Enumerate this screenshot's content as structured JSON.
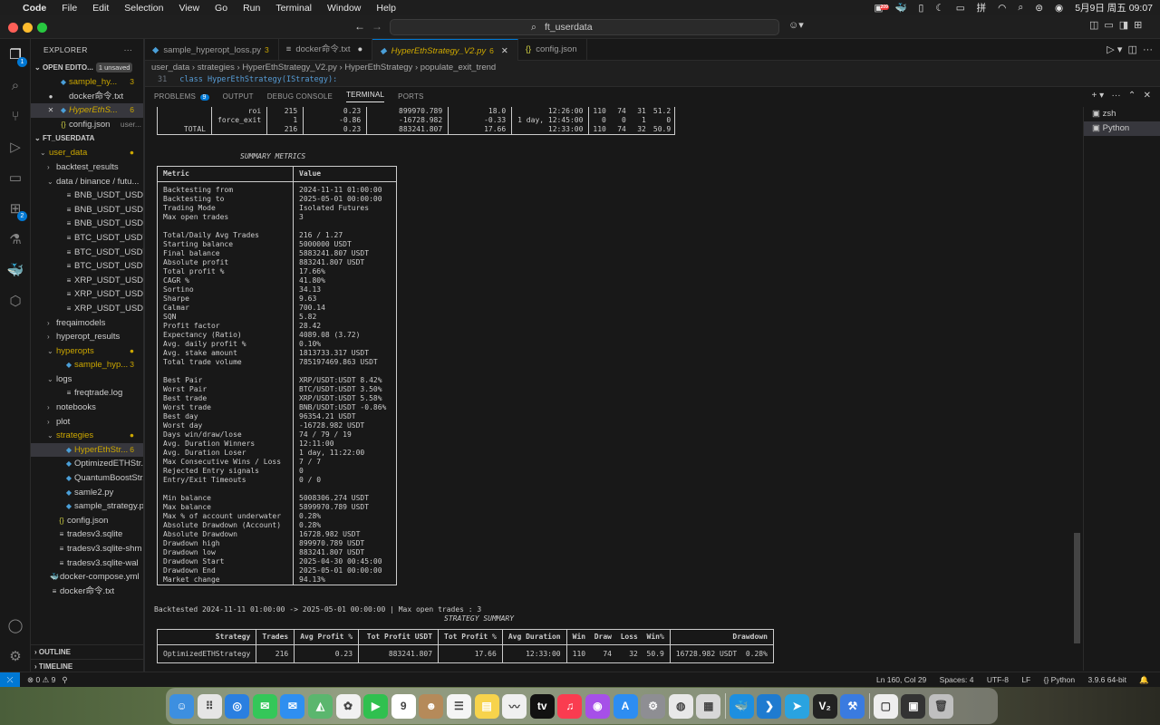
{
  "menubar": {
    "app": "Code",
    "items": [
      "File",
      "Edit",
      "Selection",
      "View",
      "Go",
      "Run",
      "Terminal",
      "Window",
      "Help"
    ],
    "ime": "拼",
    "datetime": "5月9日 周五  09:07",
    "notif_badge": "209"
  },
  "titlebar": {
    "search": "ft_userdata"
  },
  "activity": {
    "source_control_badge": "2",
    "extensions_badge": "2"
  },
  "sidebar": {
    "title": "EXPLORER",
    "open_editors_label": "OPEN EDITO...",
    "unsaved_label": "1 unsaved",
    "open_editors": [
      {
        "name": "sample_hy...",
        "badge": "3",
        "lead": "",
        "icon": "python-file-icon",
        "cls": "pyc",
        "glyph": "◆"
      },
      {
        "name": "docker命令.txt",
        "badge": "",
        "lead": "●",
        "icon": "text-file-icon",
        "cls": "",
        "glyph": ""
      },
      {
        "name": "HyperEthS...",
        "badge": "6",
        "lead": "✕",
        "icon": "python-file-icon",
        "cls": "pyc",
        "glyph": "◆"
      },
      {
        "name": "config.json",
        "badge": "user...",
        "lead": "",
        "icon": "json-file-icon",
        "cls": "jsc",
        "glyph": "{}"
      }
    ],
    "workspace_label": "FT_USERDATA",
    "tree": [
      {
        "indent": 0,
        "tw": "⌄",
        "name": "user_data",
        "badge": "●",
        "cls": "",
        "glyph": "",
        "color": "#cca700"
      },
      {
        "indent": 1,
        "tw": "›",
        "name": "backtest_results",
        "badge": "",
        "cls": "",
        "glyph": ""
      },
      {
        "indent": 1,
        "tw": "⌄",
        "name": "data / binance / futu...",
        "badge": "",
        "cls": "",
        "glyph": ""
      },
      {
        "indent": 2,
        "tw": "",
        "name": "BNB_USDT_USDT...",
        "badge": "",
        "cls": "",
        "glyph": "≡"
      },
      {
        "indent": 2,
        "tw": "",
        "name": "BNB_USDT_USDT...",
        "badge": "",
        "cls": "",
        "glyph": "≡"
      },
      {
        "indent": 2,
        "tw": "",
        "name": "BNB_USDT_USDT...",
        "badge": "",
        "cls": "",
        "glyph": "≡"
      },
      {
        "indent": 2,
        "tw": "",
        "name": "BTC_USDT_USDT...",
        "badge": "",
        "cls": "",
        "glyph": "≡"
      },
      {
        "indent": 2,
        "tw": "",
        "name": "BTC_USDT_USDT...",
        "badge": "",
        "cls": "",
        "glyph": "≡"
      },
      {
        "indent": 2,
        "tw": "",
        "name": "BTC_USDT_USDT...",
        "badge": "",
        "cls": "",
        "glyph": "≡"
      },
      {
        "indent": 2,
        "tw": "",
        "name": "XRP_USDT_USDT...",
        "badge": "",
        "cls": "",
        "glyph": "≡"
      },
      {
        "indent": 2,
        "tw": "",
        "name": "XRP_USDT_USDT...",
        "badge": "",
        "cls": "",
        "glyph": "≡"
      },
      {
        "indent": 2,
        "tw": "",
        "name": "XRP_USDT_USDT...",
        "badge": "",
        "cls": "",
        "glyph": "≡"
      },
      {
        "indent": 1,
        "tw": "›",
        "name": "freqaimodels",
        "badge": "",
        "cls": "",
        "glyph": ""
      },
      {
        "indent": 1,
        "tw": "›",
        "name": "hyperopt_results",
        "badge": "",
        "cls": "",
        "glyph": ""
      },
      {
        "indent": 1,
        "tw": "⌄",
        "name": "hyperopts",
        "badge": "●",
        "cls": "",
        "glyph": "",
        "color": "#cca700"
      },
      {
        "indent": 2,
        "tw": "",
        "name": "sample_hyp...",
        "badge": "3",
        "cls": "pyc",
        "glyph": "◆",
        "color": "#cca700"
      },
      {
        "indent": 1,
        "tw": "⌄",
        "name": "logs",
        "badge": "",
        "cls": "",
        "glyph": ""
      },
      {
        "indent": 2,
        "tw": "",
        "name": "freqtrade.log",
        "badge": "",
        "cls": "",
        "glyph": "≡"
      },
      {
        "indent": 1,
        "tw": "›",
        "name": "notebooks",
        "badge": "",
        "cls": "",
        "glyph": ""
      },
      {
        "indent": 1,
        "tw": "›",
        "name": "plot",
        "badge": "",
        "cls": "",
        "glyph": ""
      },
      {
        "indent": 1,
        "tw": "⌄",
        "name": "strategies",
        "badge": "●",
        "cls": "",
        "glyph": "",
        "color": "#cca700"
      },
      {
        "indent": 2,
        "tw": "",
        "name": "HyperEthStr...",
        "badge": "6",
        "cls": "pyc",
        "glyph": "◆",
        "color": "#cca700",
        "sel": true
      },
      {
        "indent": 2,
        "tw": "",
        "name": "OptimizedETHStr...",
        "badge": "",
        "cls": "pyc",
        "glyph": "◆"
      },
      {
        "indent": 2,
        "tw": "",
        "name": "QuantumBoostStr...",
        "badge": "",
        "cls": "pyc",
        "glyph": "◆"
      },
      {
        "indent": 2,
        "tw": "",
        "name": "samle2.py",
        "badge": "",
        "cls": "pyc",
        "glyph": "◆"
      },
      {
        "indent": 2,
        "tw": "",
        "name": "sample_strategy.py",
        "badge": "",
        "cls": "pyc",
        "glyph": "◆"
      },
      {
        "indent": 1,
        "tw": "",
        "name": "config.json",
        "badge": "",
        "cls": "jsc",
        "glyph": "{}"
      },
      {
        "indent": 1,
        "tw": "",
        "name": "tradesv3.sqlite",
        "badge": "",
        "cls": "",
        "glyph": "≡"
      },
      {
        "indent": 1,
        "tw": "",
        "name": "tradesv3.sqlite-shm",
        "badge": "",
        "cls": "",
        "glyph": "≡"
      },
      {
        "indent": 1,
        "tw": "",
        "name": "tradesv3.sqlite-wal",
        "badge": "",
        "cls": "",
        "glyph": "≡"
      },
      {
        "indent": 0,
        "tw": "",
        "name": "docker-compose.yml",
        "badge": "",
        "cls": "yc",
        "glyph": "🐳"
      },
      {
        "indent": 0,
        "tw": "",
        "name": "docker命令.txt",
        "badge": "",
        "cls": "",
        "glyph": "≡"
      }
    ],
    "outline_label": "OUTLINE",
    "timeline_label": "TIMELINE"
  },
  "tabs": [
    {
      "label": "sample_hyperopt_loss.py",
      "num": "3",
      "dot": "",
      "active": false
    },
    {
      "label": "docker命令.txt",
      "num": "",
      "dot": "●",
      "active": false
    },
    {
      "label": "HyperEthStrategy_V2.py",
      "num": "6",
      "dot": "",
      "active": true
    },
    {
      "label": "config.json",
      "num": "",
      "dot": "",
      "active": false
    }
  ],
  "breadcrumb": "user_data  ›  strategies  ›  HyperEthStrategy_V2.py  ›  HyperEthStrategy  ›  populate_exit_trend",
  "code_line": {
    "num": "31",
    "text": "class HyperEthStrategy(IStrategy):"
  },
  "panel": {
    "tabs": [
      "PROBLEMS",
      "OUTPUT",
      "DEBUG CONSOLE",
      "TERMINAL",
      "PORTS"
    ],
    "problems_badge": "9",
    "active_tab": "TERMINAL",
    "terminals": [
      "zsh",
      "Python"
    ]
  },
  "top_table": {
    "rows": [
      [
        "",
        "roi",
        "215",
        "0.23",
        "899970.789",
        "18.0",
        "12:26:00",
        "110",
        "74",
        "31",
        "51.2"
      ],
      [
        "",
        "force_exit",
        "1",
        "-0.86",
        "-16728.982",
        "-0.33",
        "1 day, 12:45:00",
        "0",
        "0",
        "1",
        "0"
      ],
      [
        "TOTAL",
        "",
        "216",
        "0.23",
        "883241.807",
        "17.66",
        "12:33:00",
        "110",
        "74",
        "32",
        "50.9"
      ]
    ]
  },
  "summary_title": "SUMMARY METRICS",
  "summary": {
    "headers": [
      "Metric",
      "Value"
    ],
    "rows": [
      [
        "Backtesting from",
        "2024-11-11 01:00:00"
      ],
      [
        "Backtesting to",
        "2025-05-01 00:00:00"
      ],
      [
        "Trading Mode",
        "Isolated Futures"
      ],
      [
        "Max open trades",
        "3"
      ],
      [
        "",
        ""
      ],
      [
        "Total/Daily Avg Trades",
        "216 / 1.27"
      ],
      [
        "Starting balance",
        "5000000 USDT"
      ],
      [
        "Final balance",
        "5883241.807 USDT"
      ],
      [
        "Absolute profit",
        "883241.807 USDT"
      ],
      [
        "Total profit %",
        "17.66%"
      ],
      [
        "CAGR %",
        "41.80%"
      ],
      [
        "Sortino",
        "34.13"
      ],
      [
        "Sharpe",
        "9.63"
      ],
      [
        "Calmar",
        "700.14"
      ],
      [
        "SQN",
        "5.82"
      ],
      [
        "Profit factor",
        "28.42"
      ],
      [
        "Expectancy (Ratio)",
        "4089.08 (3.72)"
      ],
      [
        "Avg. daily profit %",
        "0.10%"
      ],
      [
        "Avg. stake amount",
        "1813733.317 USDT"
      ],
      [
        "Total trade volume",
        "785197469.863 USDT"
      ],
      [
        "",
        ""
      ],
      [
        "Best Pair",
        "XRP/USDT:USDT 8.42%"
      ],
      [
        "Worst Pair",
        "BTC/USDT:USDT 3.50%"
      ],
      [
        "Best trade",
        "XRP/USDT:USDT 5.58%"
      ],
      [
        "Worst trade",
        "BNB/USDT:USDT -0.86%"
      ],
      [
        "Best day",
        "96354.21 USDT"
      ],
      [
        "Worst day",
        "-16728.982 USDT"
      ],
      [
        "Days win/draw/lose",
        "74 / 79 / 19"
      ],
      [
        "Avg. Duration Winners",
        "12:11:00"
      ],
      [
        "Avg. Duration Loser",
        "1 day, 11:22:00"
      ],
      [
        "Max Consecutive Wins / Loss",
        "7 / 7"
      ],
      [
        "Rejected Entry signals",
        "0"
      ],
      [
        "Entry/Exit Timeouts",
        "0 / 0"
      ],
      [
        "",
        ""
      ],
      [
        "Min balance",
        "5008306.274 USDT"
      ],
      [
        "Max balance",
        "5899970.789 USDT"
      ],
      [
        "Max % of account underwater",
        "0.28%"
      ],
      [
        "Absolute Drawdown (Account)",
        "0.28%"
      ],
      [
        "Absolute Drawdown",
        "16728.982 USDT"
      ],
      [
        "Drawdown high",
        "899970.789 USDT"
      ],
      [
        "Drawdown low",
        "883241.807 USDT"
      ],
      [
        "Drawdown Start",
        "2025-04-30 00:45:00"
      ],
      [
        "Drawdown End",
        "2025-05-01 00:00:00"
      ],
      [
        "Market change",
        "94.13%"
      ]
    ]
  },
  "backtested_line": "Backtested 2024-11-11 01:00:00 -> 2025-05-01 00:00:00 | Max open trades : 3",
  "strategy_title": "STRATEGY SUMMARY",
  "strategy": {
    "headers": [
      "Strategy",
      "Trades",
      "Avg Profit %",
      "Tot Profit USDT",
      "Tot Profit %",
      "Avg Duration",
      "Win  Draw  Loss  Win%",
      "Drawdown"
    ],
    "row": [
      "OptimizedETHStrategy",
      "216",
      "0.23",
      "883241.807",
      "17.66",
      "12:33:00",
      "110    74    32  50.9",
      "16728.982 USDT  0.28%"
    ]
  },
  "status": {
    "errors": "0",
    "warnings": "9",
    "position": "Ln 160, Col 29",
    "spaces": "Spaces: 4",
    "encoding": "UTF-8",
    "eol": "LF",
    "language": "{} Python",
    "interpreter": "3.9.6 64-bit"
  },
  "dock": {
    "calendar_day": "9",
    "apps": [
      {
        "name": "finder",
        "color": "#3d8fe0",
        "glyph": "☺"
      },
      {
        "name": "launchpad",
        "color": "#e5e5e5",
        "glyph": "⠿"
      },
      {
        "name": "safari",
        "color": "#2a7fe0",
        "glyph": "◎"
      },
      {
        "name": "messages",
        "color": "#34c759",
        "glyph": "✉"
      },
      {
        "name": "mail",
        "color": "#2f8ff0",
        "glyph": "✉"
      },
      {
        "name": "maps",
        "color": "#5bb66e",
        "glyph": "◭"
      },
      {
        "name": "photos",
        "color": "#f1f1f1",
        "glyph": "✿"
      },
      {
        "name": "facetime",
        "color": "#30c04f",
        "glyph": "▶"
      },
      {
        "name": "calendar",
        "color": "#ffffff",
        "glyph": "9"
      },
      {
        "name": "contacts",
        "color": "#b58a5a",
        "glyph": "☻"
      },
      {
        "name": "reminders",
        "color": "#f5f5f5",
        "glyph": "☰"
      },
      {
        "name": "notes",
        "color": "#f7d34c",
        "glyph": "▤"
      },
      {
        "name": "freeform",
        "color": "#f0f0f0",
        "glyph": "〰"
      },
      {
        "name": "tv",
        "color": "#111111",
        "glyph": "tv"
      },
      {
        "name": "music",
        "color": "#fa3c50",
        "glyph": "♫"
      },
      {
        "name": "podcasts",
        "color": "#a650e8",
        "glyph": "◉"
      },
      {
        "name": "app-store",
        "color": "#2d8df2",
        "glyph": "A"
      },
      {
        "name": "system-settings",
        "color": "#8e8e93",
        "glyph": "⚙"
      },
      {
        "name": "chrome",
        "color": "#e8e8e8",
        "glyph": "◍"
      },
      {
        "name": "preview",
        "color": "#d8d8d8",
        "glyph": "▦"
      },
      {
        "name": "docker",
        "color": "#1d8fe0",
        "glyph": "🐳"
      },
      {
        "name": "vscode",
        "color": "#1f7bd0",
        "glyph": "❯"
      },
      {
        "name": "telegram",
        "color": "#2aa3e0",
        "glyph": "➤"
      },
      {
        "name": "v2ray",
        "color": "#222222",
        "glyph": "V₂"
      },
      {
        "name": "xcode-tool",
        "color": "#3a7be0",
        "glyph": "⚒"
      },
      {
        "name": "document",
        "color": "#eeeeee",
        "glyph": "▢"
      },
      {
        "name": "terminal-window",
        "color": "#333333",
        "glyph": "▣"
      },
      {
        "name": "trash",
        "color": "#bfbfbf",
        "glyph": "🗑"
      }
    ]
  }
}
